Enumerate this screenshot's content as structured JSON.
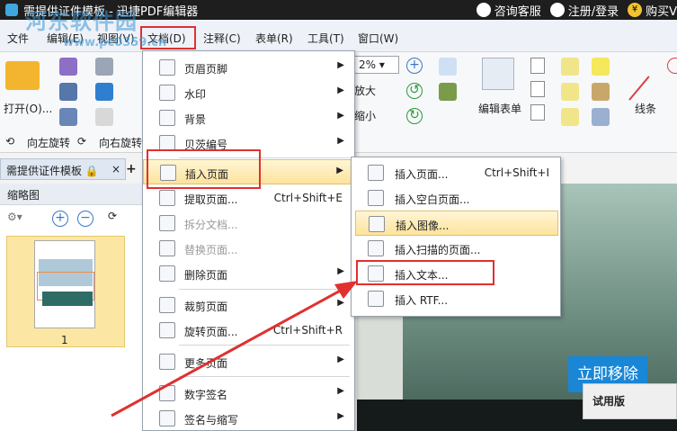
{
  "titlebar": {
    "title": "需提供证件模板 - 迅捷PDF编辑器",
    "support": "咨询客服",
    "login": "注册/登录",
    "buy": "购买V",
    "coin_glyph": "¥"
  },
  "watermark": {
    "line1": "河东软件园",
    "line2": "www.pc0359.cn"
  },
  "menubar": {
    "items": [
      "文件",
      "编辑(E)",
      "视图(V)",
      "文档(D)",
      "注释(C)",
      "表单(R)",
      "工具(T)",
      "窗口(W)"
    ]
  },
  "ribbon": {
    "open": "打开(O)...",
    "zoom": "2%",
    "enlarge": "放大",
    "shrink": "缩小",
    "edit_form": "编辑表单",
    "lines": "线条",
    "rotate_left": "向左旋转",
    "rotate_right": "向右旋转"
  },
  "doc_tab": {
    "label": "需提供证件模板",
    "close": "×",
    "add": "+"
  },
  "thumbnails": {
    "title": "缩略图",
    "page_number": "1",
    "zoom_in": "+",
    "zoom_out": "−"
  },
  "menu_document": {
    "items": [
      {
        "label": "页眉页脚",
        "shortcut": "",
        "submenu": true,
        "disabled": false
      },
      {
        "label": "水印",
        "shortcut": "",
        "submenu": true,
        "disabled": false
      },
      {
        "label": "背景",
        "shortcut": "",
        "submenu": true,
        "disabled": false
      },
      {
        "label": "贝茨编号",
        "shortcut": "",
        "submenu": true,
        "disabled": false
      },
      {
        "label": "插入页面",
        "shortcut": "",
        "submenu": true,
        "disabled": false
      },
      {
        "label": "提取页面...",
        "shortcut": "Ctrl+Shift+E",
        "submenu": false,
        "disabled": false
      },
      {
        "label": "拆分文档...",
        "shortcut": "",
        "submenu": false,
        "disabled": true
      },
      {
        "label": "替换页面...",
        "shortcut": "",
        "submenu": false,
        "disabled": true
      },
      {
        "label": "删除页面",
        "shortcut": "",
        "submenu": true,
        "disabled": false
      },
      {
        "label": "裁剪页面",
        "shortcut": "",
        "submenu": true,
        "disabled": false
      },
      {
        "label": "旋转页面...",
        "shortcut": "Ctrl+Shift+R",
        "submenu": false,
        "disabled": false
      },
      {
        "label": "更多页面",
        "shortcut": "",
        "submenu": true,
        "disabled": false
      },
      {
        "label": "数字签名",
        "shortcut": "",
        "submenu": true,
        "disabled": false
      },
      {
        "label": "签名与缩写",
        "shortcut": "",
        "submenu": true,
        "disabled": false
      }
    ]
  },
  "menu_insert": {
    "items": [
      {
        "label": "插入页面...",
        "shortcut": "Ctrl+Shift+I"
      },
      {
        "label": "插入空白页面...",
        "shortcut": ""
      },
      {
        "label": "插入图像...",
        "shortcut": ""
      },
      {
        "label": "插入扫描的页面...",
        "shortcut": ""
      },
      {
        "label": "插入文本...",
        "shortcut": ""
      },
      {
        "label": "插入 RTF...",
        "shortcut": ""
      }
    ]
  },
  "document": {
    "promo": "立即移除",
    "trial": "试用版"
  },
  "colors": {
    "highlight_border": "#e03030",
    "menu_highlight": "#fde39c",
    "accent": "#1a86d6"
  }
}
